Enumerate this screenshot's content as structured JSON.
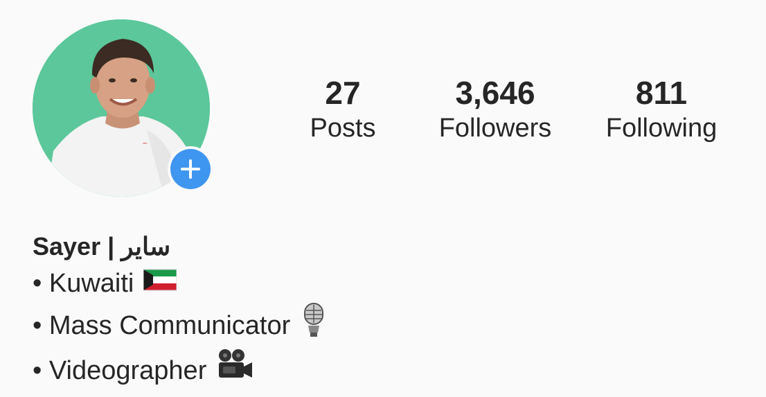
{
  "profile": {
    "stats": [
      {
        "value": "27",
        "label": "Posts"
      },
      {
        "value": "3,646",
        "label": "Followers"
      },
      {
        "value": "811",
        "label": "Following"
      }
    ],
    "name": "Sayer | ساير",
    "bio": [
      {
        "text": "• Kuwaiti",
        "emoji": "kuwait-flag-icon"
      },
      {
        "text": "• Mass Communicator",
        "emoji": "microphone-icon"
      },
      {
        "text": "• Videographer",
        "emoji": "video-camera-icon"
      }
    ]
  },
  "colors": {
    "background": "#fafafa",
    "avatar_bg": "#5cc79a",
    "add_button": "#3f96f0",
    "text": "#262626"
  }
}
